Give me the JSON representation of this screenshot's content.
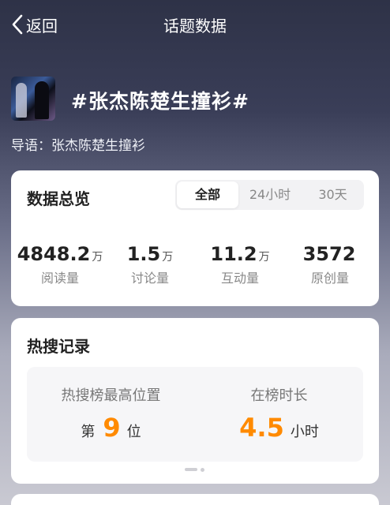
{
  "nav": {
    "back_label": "返回",
    "title": "话题数据"
  },
  "topic": {
    "name": "#张杰陈楚生撞衫#",
    "guide": "导语：张杰陈楚生撞衫"
  },
  "overview": {
    "title": "数据总览",
    "tabs": [
      {
        "label": "全部",
        "active": true
      },
      {
        "label": "24小时",
        "active": false
      },
      {
        "label": "30天",
        "active": false
      }
    ],
    "stats": [
      {
        "value": "4848.2",
        "unit": "万",
        "label": "阅读量"
      },
      {
        "value": "1.5",
        "unit": "万",
        "label": "讨论量"
      },
      {
        "value": "11.2",
        "unit": "万",
        "label": "互动量"
      },
      {
        "value": "3572",
        "unit": "",
        "label": "原创量"
      }
    ]
  },
  "hot_search": {
    "title": "热搜记录",
    "peak": {
      "label": "热搜榜最高位置",
      "prefix": "第",
      "value": "9",
      "suffix": "位"
    },
    "duration": {
      "label": "在榜时长",
      "value": "4.5",
      "suffix": "小时"
    },
    "pager": {
      "pages": 2,
      "current": 1
    }
  },
  "colors": {
    "accent": "#ff8a00",
    "card": "#ffffff",
    "text_primary": "#222222",
    "text_secondary": "#888888"
  },
  "icons": {
    "back": "chevron-left-icon"
  }
}
